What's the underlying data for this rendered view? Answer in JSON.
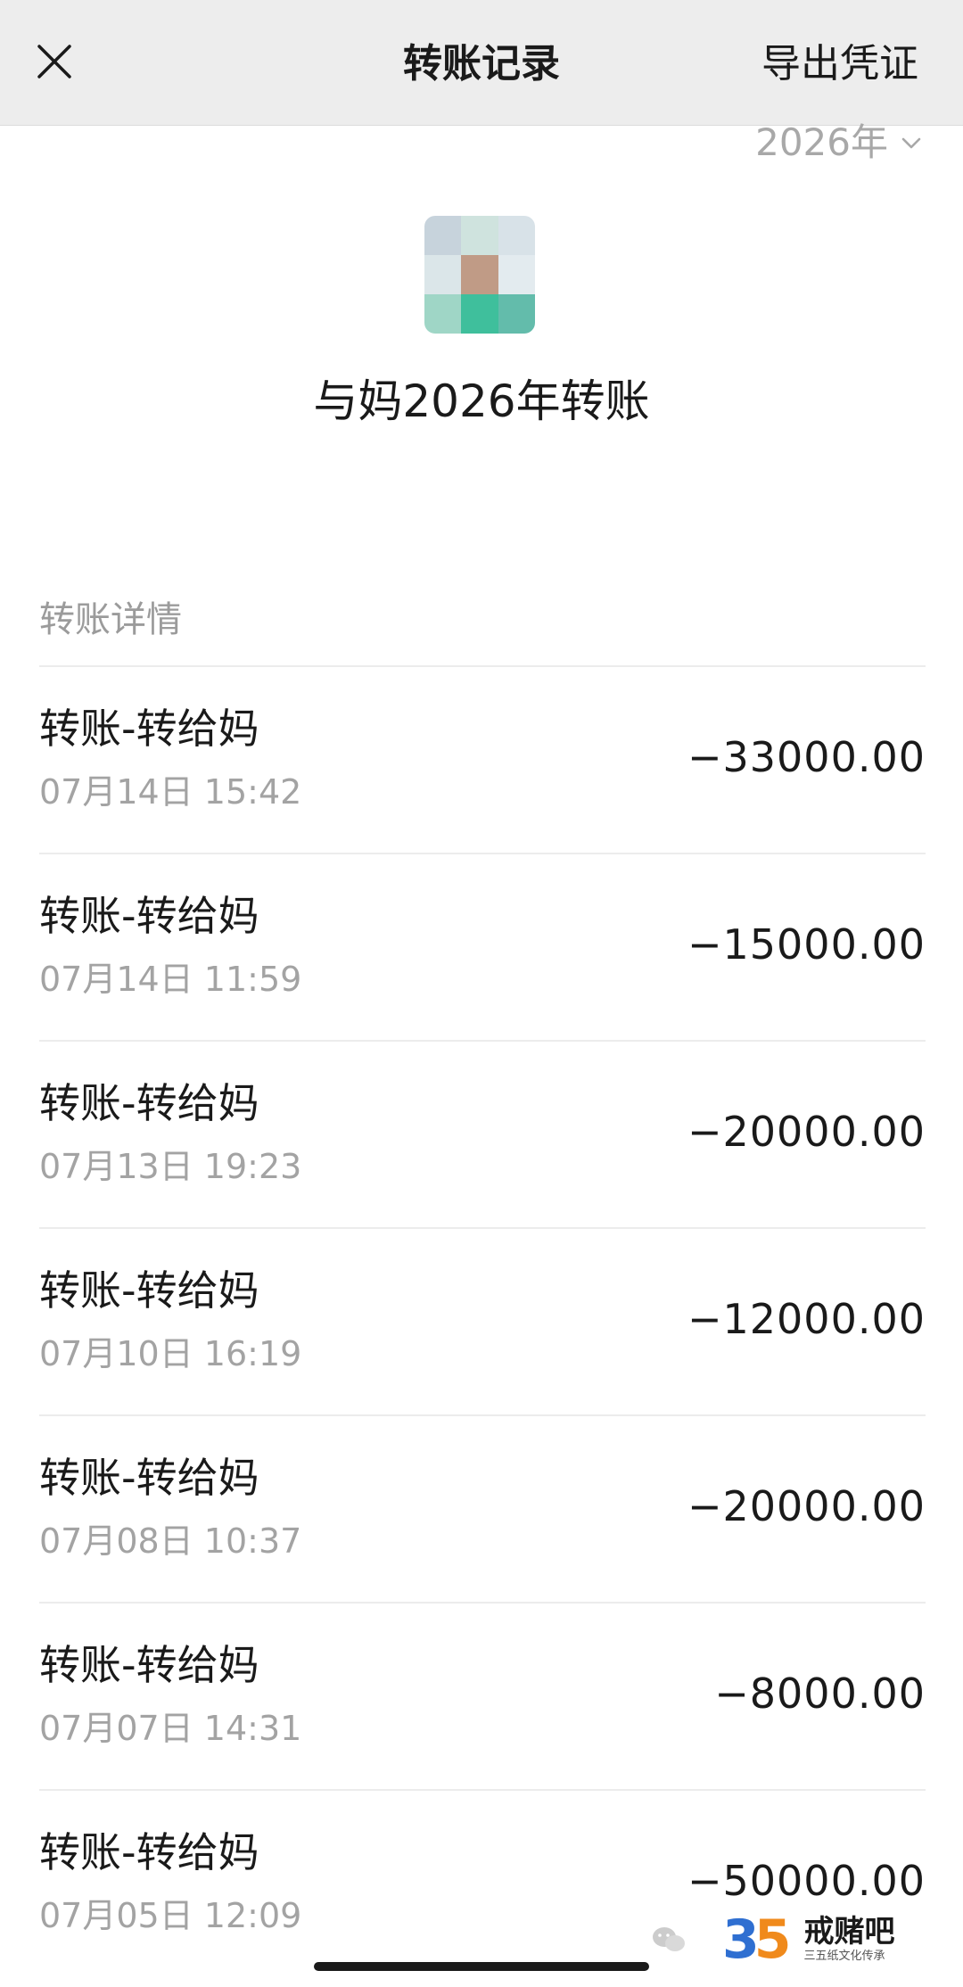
{
  "header": {
    "title": "转账记录",
    "export_label": "导出凭证"
  },
  "year_filter": {
    "value": "2026年"
  },
  "contact": {
    "title": "与妈2026年转账",
    "avatar_colors": [
      "#c7d3dc",
      "#cfe3de",
      "#d8e2e8",
      "#dbe6e9",
      "#c09b86",
      "#e3ebef",
      "#9fd6c6",
      "#3fbf9c",
      "#63bcab"
    ]
  },
  "section": {
    "label": "转账详情"
  },
  "transactions": [
    {
      "title": "转账-转给妈",
      "time": "07月14日 15:42",
      "amount": "−33000.00"
    },
    {
      "title": "转账-转给妈",
      "time": "07月14日 11:59",
      "amount": "−15000.00"
    },
    {
      "title": "转账-转给妈",
      "time": "07月13日 19:23",
      "amount": "−20000.00"
    },
    {
      "title": "转账-转给妈",
      "time": "07月10日 16:19",
      "amount": "−12000.00"
    },
    {
      "title": "转账-转给妈",
      "time": "07月08日 10:37",
      "amount": "−20000.00"
    },
    {
      "title": "转账-转给妈",
      "time": "07月07日 14:31",
      "amount": "−8000.00"
    },
    {
      "title": "转账-转给妈",
      "time": "07月05日 12:09",
      "amount": "−50000.00"
    }
  ],
  "watermark": {
    "logo_number_left": "3",
    "logo_number_right": "5",
    "name": "戒赌吧",
    "subtitle": "三五纸文化传承"
  },
  "icons": {
    "close": "close-icon",
    "chevron": "chevron-down-icon",
    "wechat": "wechat-icon"
  }
}
